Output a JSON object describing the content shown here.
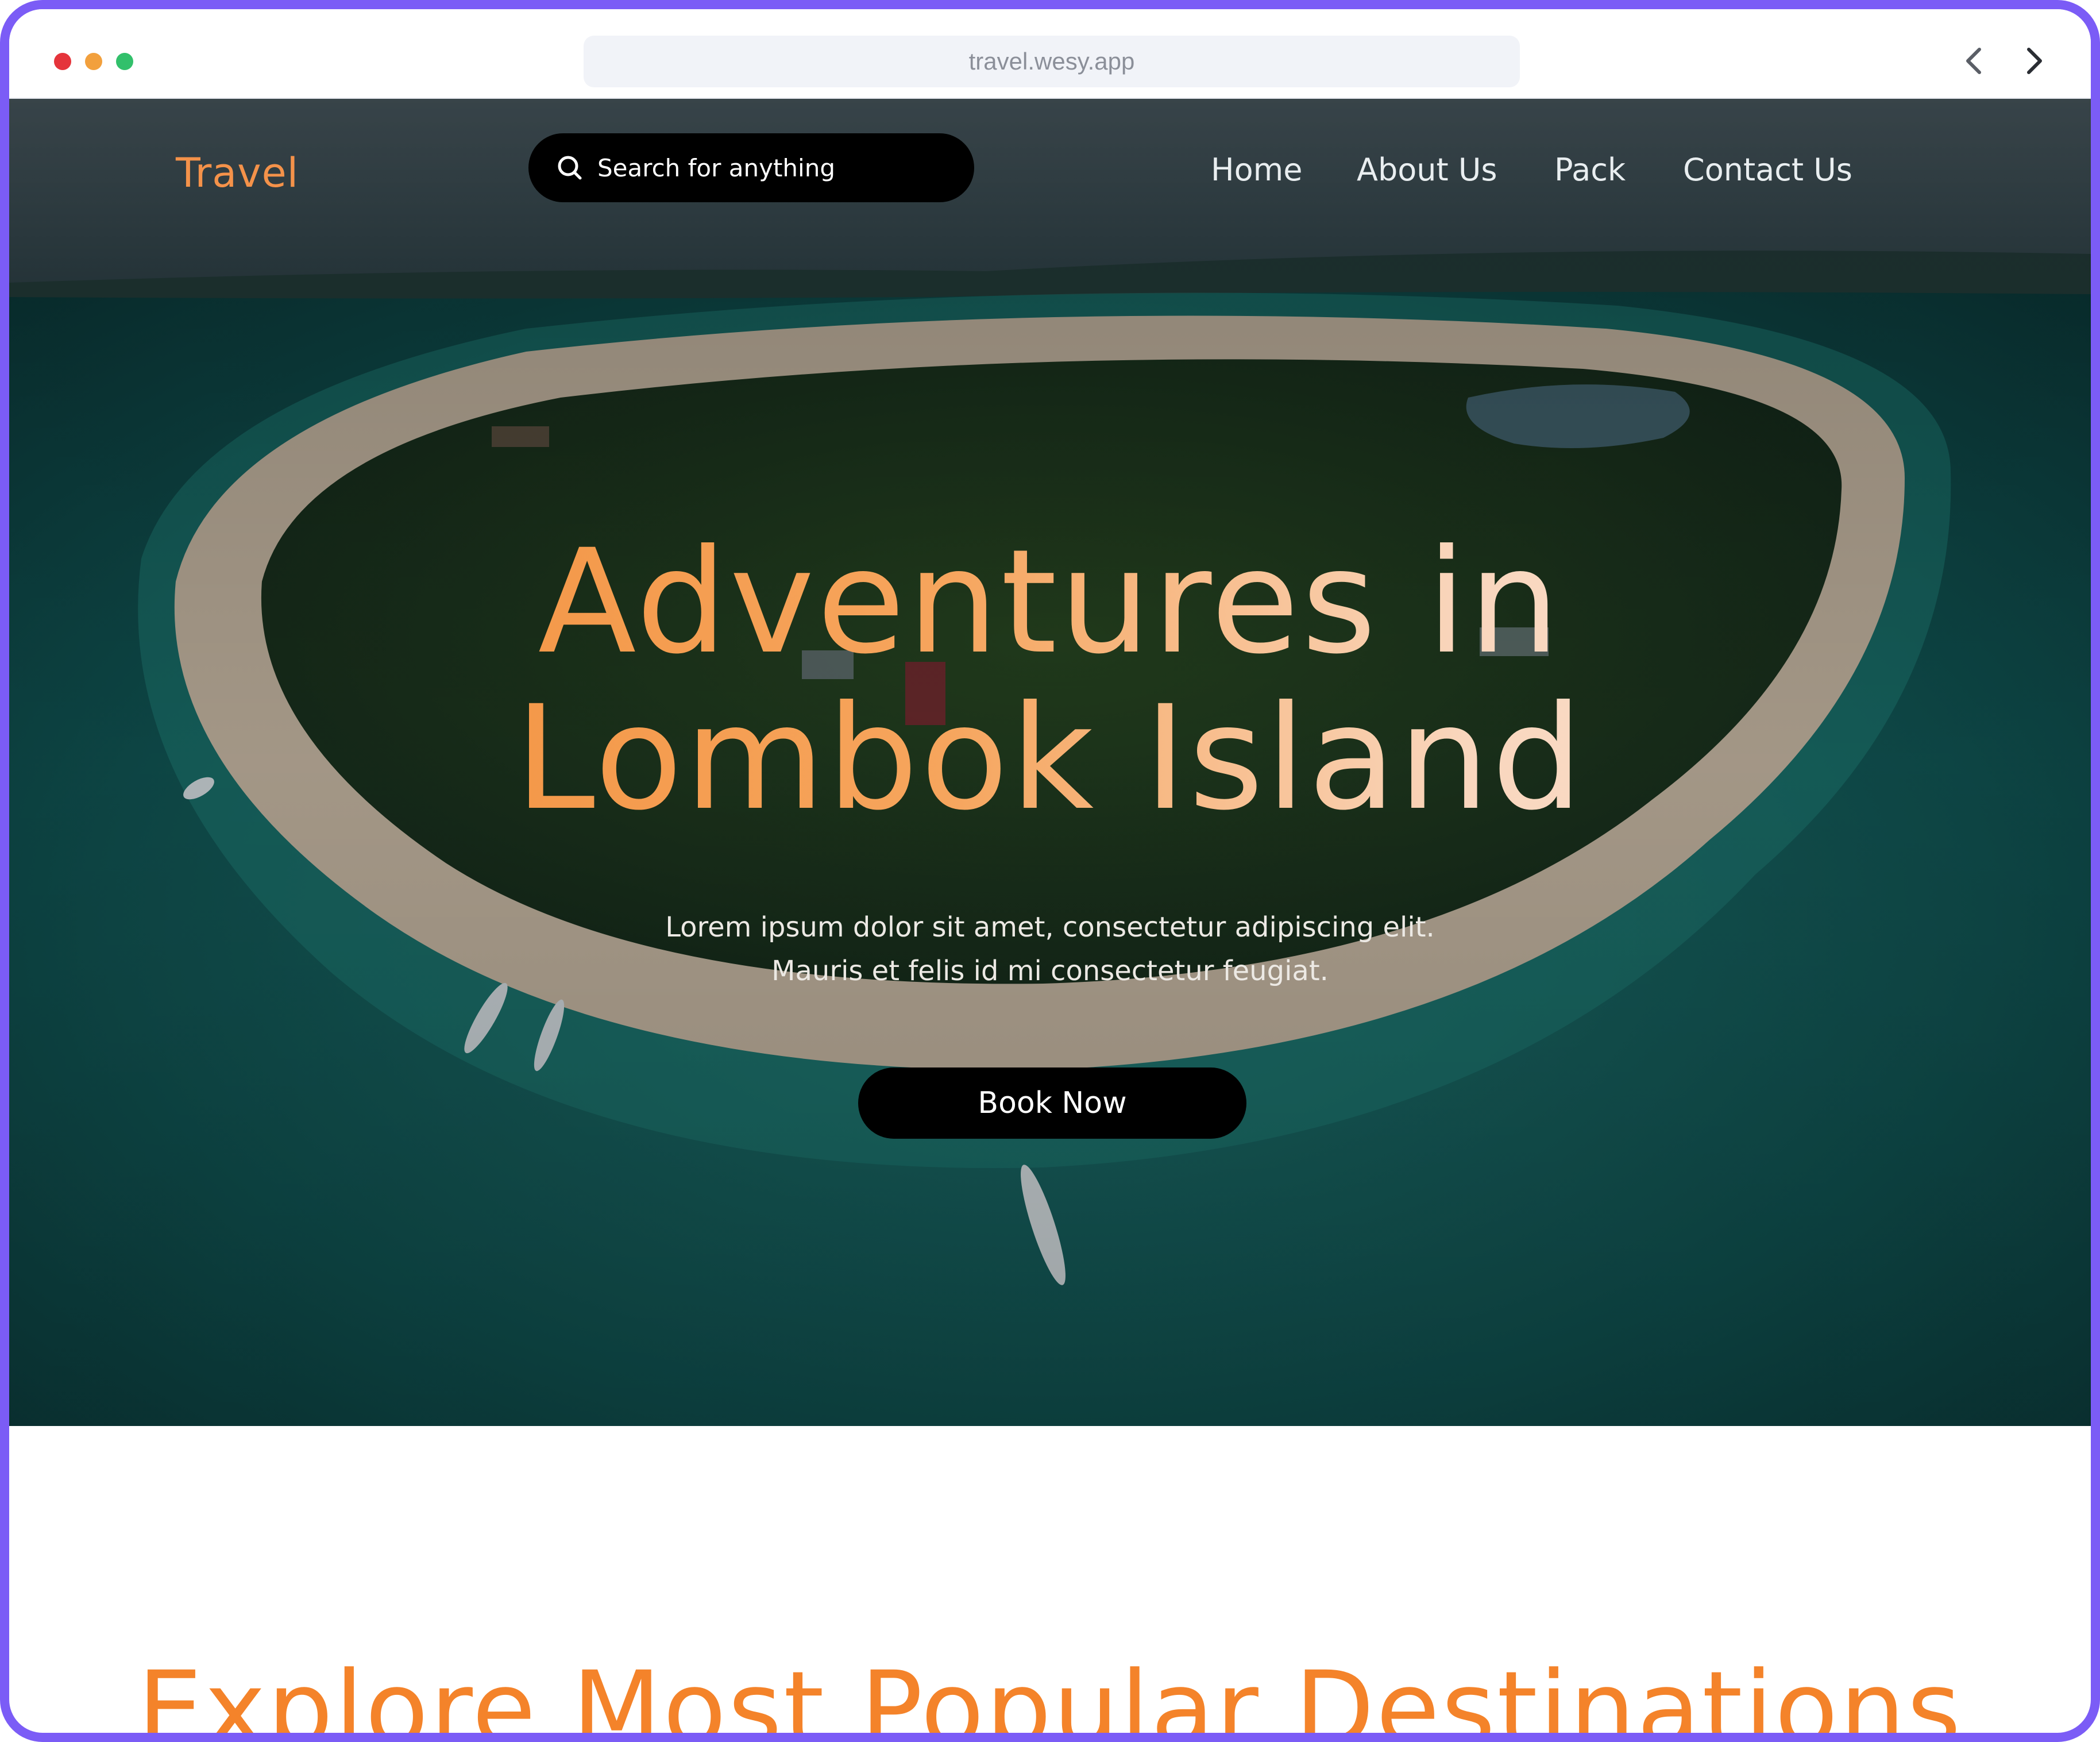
{
  "browser": {
    "url": "travel.wesy.app",
    "back_icon": "chevron-left-icon",
    "forward_icon": "chevron-right-icon"
  },
  "header": {
    "logo": "Travel",
    "search_placeholder": "Search for anything",
    "nav": [
      "Home",
      "About Us",
      "Pack",
      "Contact Us"
    ]
  },
  "hero": {
    "title_line1": "Adventures in",
    "title_line2": "Lombok Island",
    "description_line1": "Lorem ipsum dolor sit amet, consectetur adipiscing elit.",
    "description_line2": "Mauris et felis id mi consectetur feugiat.",
    "cta": "Book Now"
  },
  "section": {
    "title": "Explore Most Popular Destinations"
  },
  "colors": {
    "accent": "#f4832a",
    "frame": "#7b5cf6",
    "button": "#000000"
  }
}
